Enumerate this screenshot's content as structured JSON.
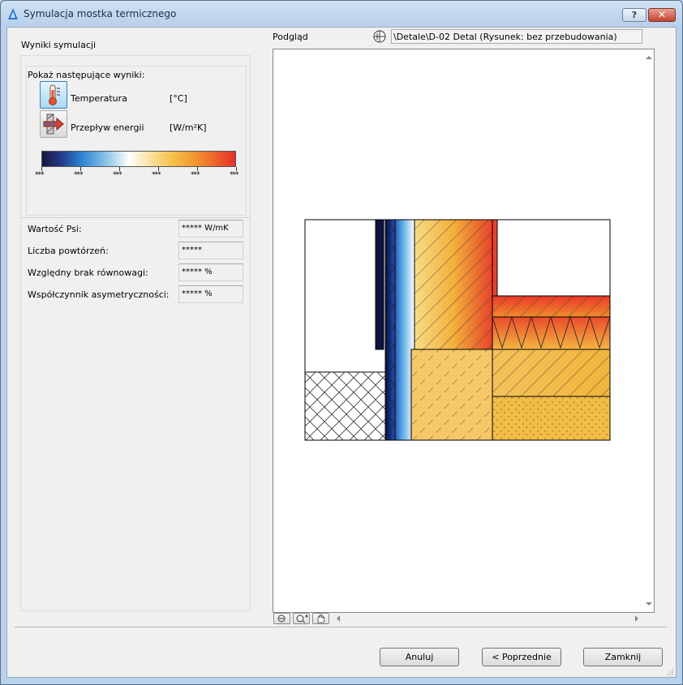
{
  "window": {
    "title": "Symulacja mostka termicznego",
    "help_label": "?",
    "close_label": "✕"
  },
  "left": {
    "section_title": "Wyniki symulacji",
    "show_label": "Pokaż następujące wyniki:",
    "options": [
      {
        "label": "Temperatura",
        "unit": "[°C]",
        "icon": "thermometer-icon",
        "active": true
      },
      {
        "label": "Przepływ energii",
        "unit": "[W/m²K]",
        "icon": "energy-flow-icon",
        "active": false
      }
    ],
    "legend_ticks": [
      "***",
      "***",
      "***",
      "***",
      "***",
      "***"
    ],
    "results": [
      {
        "label": "Wartość Psi:",
        "value": "***** W/mK"
      },
      {
        "label": "Liczba powtórzeń:",
        "value": "*****"
      },
      {
        "label": "Względny brak równowagi:",
        "value": "***** %"
      },
      {
        "label": "Współczynnik asymetryczności:",
        "value": "***** %"
      }
    ]
  },
  "preview": {
    "label": "Podgląd",
    "path": "\\Detale\\D-02 Detal (Rysunek: bez przebudowania)"
  },
  "buttons": {
    "cancel": "Anuluj",
    "previous": "< Poprzednie",
    "close": "Zamknij"
  }
}
